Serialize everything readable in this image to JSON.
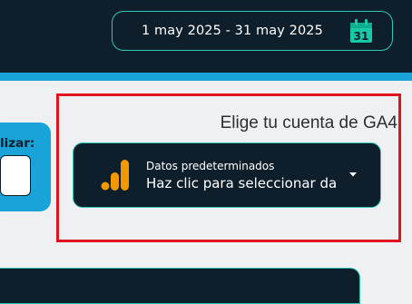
{
  "header": {
    "date_range": "1 may 2025 - 31 may 2025",
    "calendar_icon": "calendar-icon",
    "calendar_day": "31",
    "colors": {
      "background": "#0e1e2b",
      "accent_stripe": "#1aa3d9",
      "border": "#2ec7b4",
      "calendar_icon": "#19c8a6"
    }
  },
  "left_card": {
    "label": "lizar:",
    "input_value": "",
    "color": "#1aa3d9"
  },
  "ga4_selector": {
    "title": "Elige tu cuenta de GA4",
    "label": "Datos predeterminados",
    "value": "Haz clic para seleccionar da",
    "icon": "google-analytics-icon",
    "dropdown_icon": "caret-down-icon",
    "colors": {
      "background": "#0e1e2b",
      "border": "#2ec7b4",
      "icon": "#f29900",
      "highlight": "#e0141f"
    }
  }
}
